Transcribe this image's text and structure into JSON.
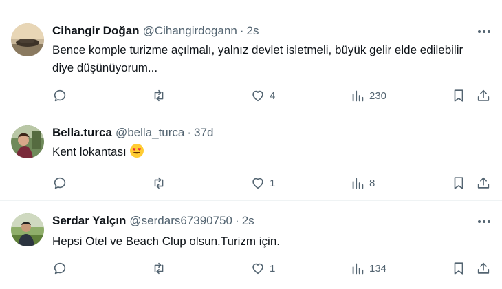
{
  "tweets": [
    {
      "name": "Cihangir Doğan",
      "handle": "@Cihangirdogann",
      "separator": "·",
      "time": "2s",
      "text": "Bence komple turizme açılmalı, yalnız devlet isletmeli, büyük gelir elde edilebilir diye düşünüyorum...",
      "replies": "",
      "retweets": "",
      "likes": "4",
      "views": "230"
    },
    {
      "name": "Bella.turca",
      "handle": "@bella_turca",
      "separator": "·",
      "time": "37d",
      "text": "Kent lokantası",
      "emoji": "heart-eyes-emoji",
      "replies": "",
      "retweets": "",
      "likes": "1",
      "views": "8"
    },
    {
      "name": "Serdar Yalçın",
      "handle": "@serdars67390750",
      "separator": "·",
      "time": "2s",
      "text": "Hepsi Otel ve Beach Clup olsun.Turizm için.",
      "replies": "",
      "retweets": "",
      "likes": "1",
      "views": "134"
    }
  ],
  "colors": {
    "text": "#0f1419",
    "secondary": "#536471",
    "divider": "#eff3f4"
  }
}
